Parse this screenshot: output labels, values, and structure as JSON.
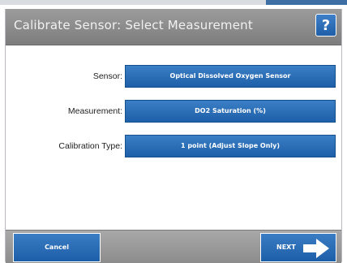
{
  "dialog": {
    "title": "Calibrate Sensor: Select Measurement",
    "help_label": "?"
  },
  "fields": [
    {
      "label": "Sensor:",
      "value": "Optical Dissolved Oxygen Sensor"
    },
    {
      "label": "Measurement:",
      "value": "DO2 Saturation (%)"
    },
    {
      "label": "Calibration Type:",
      "value": "1 point (Adjust Slope Only)"
    }
  ],
  "footer": {
    "cancel_label": "Cancel",
    "next_label": "NEXT"
  },
  "colors": {
    "accent_blue": "#2a6db8",
    "title_bar_gray": "#8a8a8a",
    "footer_gray": "#999999"
  },
  "icons": {
    "help": "question-mark-icon",
    "next": "right-arrow-icon"
  }
}
